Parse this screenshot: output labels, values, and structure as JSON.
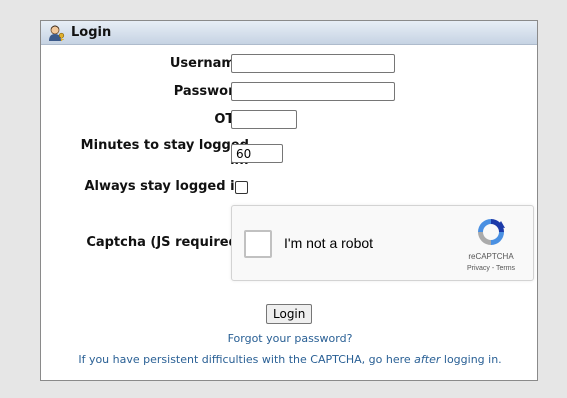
{
  "login": {
    "title": "Login",
    "username_label": "Username:",
    "username_value": "",
    "password_label": "Password:",
    "password_value": "",
    "otp_label": "OTP:",
    "otp_value": "",
    "minutes_label_line1": "Minutes to stay logged",
    "minutes_label_line2": "in:",
    "minutes_value": "60",
    "always_label": "Always stay logged in:",
    "captcha_label": "Captcha (JS required):",
    "submit_label": "Login",
    "forgot_link": "Forgot your password?",
    "note_prefix": "If you have persistent difficulties with the CAPTCHA, go here ",
    "note_emph": "after",
    "note_suffix": " logging in."
  },
  "recaptcha": {
    "checkbox_label": "I'm not a robot",
    "brand": "reCAPTCHA",
    "privacy": "Privacy",
    "separator": " - ",
    "terms": "Terms"
  },
  "colors": {
    "page_bg": "#e6e6e6",
    "header_top": "#e7eef6",
    "header_bottom": "#c6d3e3",
    "link": "#2a6095"
  },
  "icons": {
    "header": "user-key-icon",
    "recaptcha": "recaptcha-logo-icon"
  }
}
